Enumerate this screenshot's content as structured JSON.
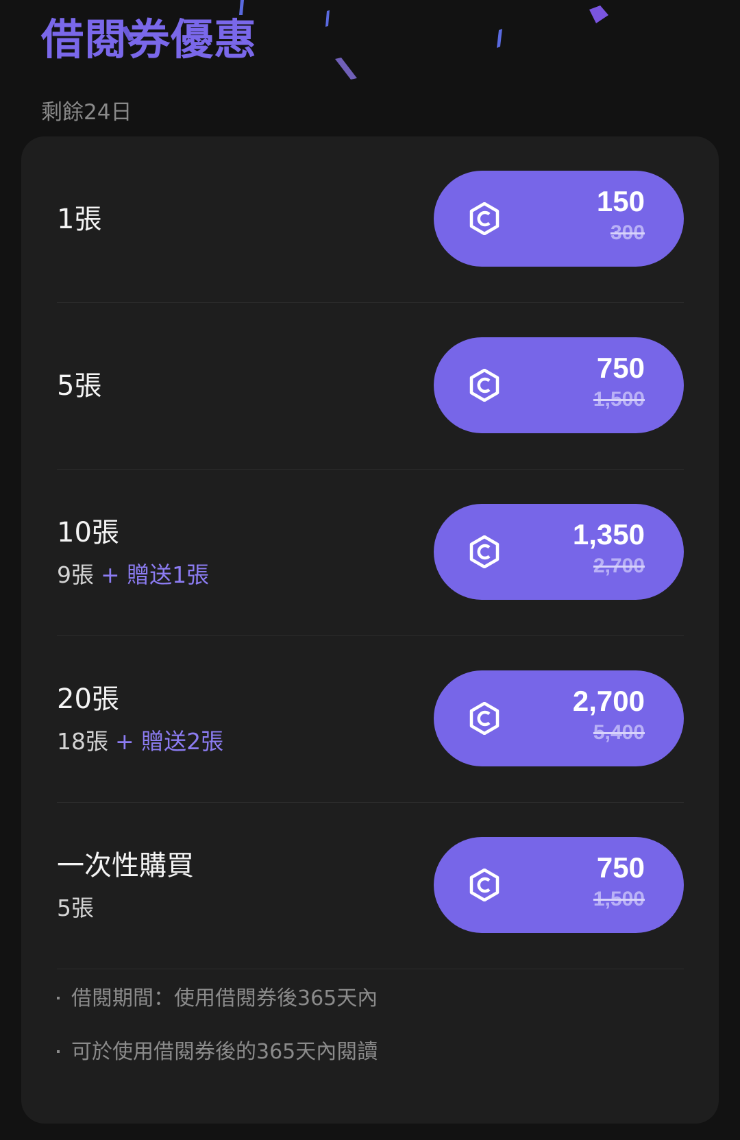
{
  "header": {
    "title": "借閱券優惠",
    "remaining": "剩餘24日"
  },
  "colors": {
    "accent": "#7766e8",
    "background": "#121212",
    "card": "#1e1e1e",
    "bonus_text": "#8c7cf2"
  },
  "coin_icon": "hexagon-c-coin-icon",
  "offers": [
    {
      "title": "1張",
      "subtitle": "",
      "bonus": "",
      "price": "150",
      "original_price": "300"
    },
    {
      "title": "5張",
      "subtitle": "",
      "bonus": "",
      "price": "750",
      "original_price": "1,500"
    },
    {
      "title": "10張",
      "subtitle": "9張",
      "bonus": "+ 贈送1張",
      "price": "1,350",
      "original_price": "2,700"
    },
    {
      "title": "20張",
      "subtitle": "18張",
      "bonus": "+ 贈送2張",
      "price": "2,700",
      "original_price": "5,400"
    },
    {
      "title": "一次性購買",
      "subtitle": "5張",
      "bonus": "",
      "price": "750",
      "original_price": "1,500"
    }
  ],
  "notes": [
    "借閱期間：使用借閱券後365天內",
    "可於使用借閱券後的365天內閱讀"
  ]
}
